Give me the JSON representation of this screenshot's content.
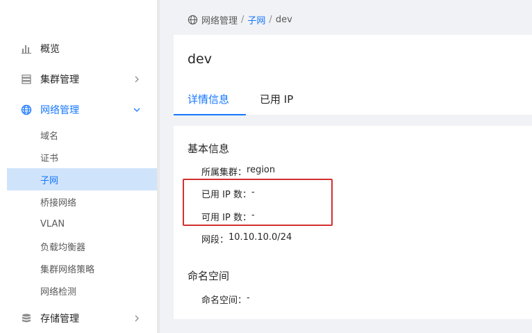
{
  "sidebar": {
    "items": [
      {
        "label": "概览",
        "icon": "bar-chart-icon"
      },
      {
        "label": "集群管理",
        "icon": "server-icon"
      },
      {
        "label": "网络管理",
        "icon": "globe-icon"
      },
      {
        "label": "存储管理",
        "icon": "database-icon"
      }
    ],
    "network_sub": [
      "域名",
      "证书",
      "子网",
      "桥接网络",
      "VLAN",
      "负载均衡器",
      "集群网络策略",
      "网络检测"
    ]
  },
  "breadcrumb": {
    "root": "网络管理",
    "separator": "/",
    "parent": "子网",
    "current": "dev"
  },
  "page": {
    "title": "dev",
    "tabs": [
      "详情信息",
      "已用 IP"
    ]
  },
  "basic": {
    "title": "基本信息",
    "fields": [
      {
        "label": "所属集群：",
        "value": "region"
      },
      {
        "label": "已用 IP 数：",
        "value": "-"
      },
      {
        "label": "可用 IP 数：",
        "value": "-"
      },
      {
        "label": "网段：",
        "value": "10.10.10.0/24"
      }
    ]
  },
  "namespace": {
    "title": "命名空间",
    "fields": [
      {
        "label": "命名空间：",
        "value": "-"
      }
    ]
  },
  "colors": {
    "accent": "#1677ff",
    "selected_bg": "#cfe3fb",
    "highlight": "#d32f2f"
  }
}
